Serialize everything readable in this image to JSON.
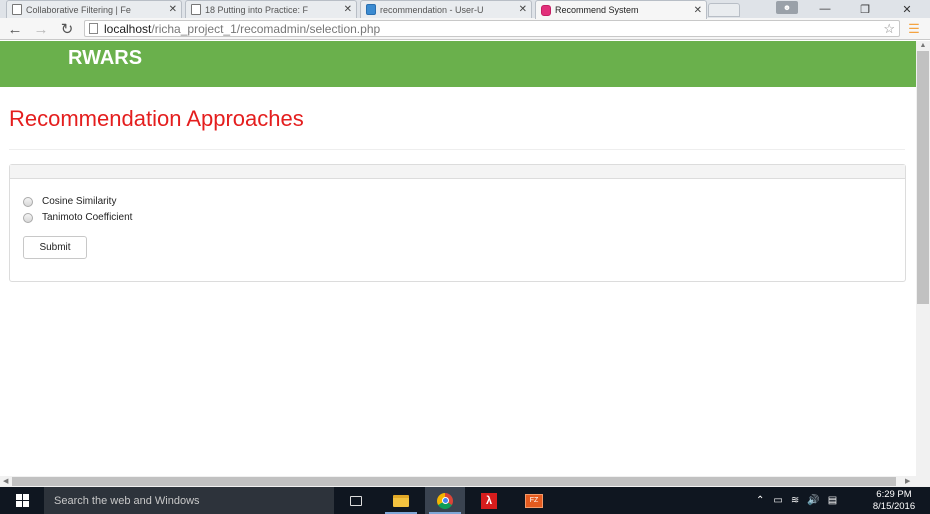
{
  "browser": {
    "tabs": [
      {
        "title": "Collaborative Filtering | Fe",
        "icon": "page-icon"
      },
      {
        "title": "18 Putting into Practice: F",
        "icon": "page-icon"
      },
      {
        "title": "recommendation - User-U",
        "icon": "stackexchange-icon"
      },
      {
        "title": "Recommend System",
        "icon": "app-icon",
        "active": true
      }
    ],
    "close_glyph": "✕",
    "address": {
      "host": "localhost",
      "path": "/richa_project_1/recomadmin/selection.php"
    }
  },
  "page": {
    "brand": "RWARS",
    "title": "Recommendation Approaches",
    "options": [
      "Cosine Similarity",
      "Tanimoto Coefficient"
    ],
    "submit_label": "Submit"
  },
  "taskbar": {
    "search_placeholder": "Search the web and Windows",
    "time": "6:29 PM",
    "date": "8/15/2016"
  },
  "colors": {
    "navbar": "#6ab04c",
    "title": "#e41e1e"
  }
}
